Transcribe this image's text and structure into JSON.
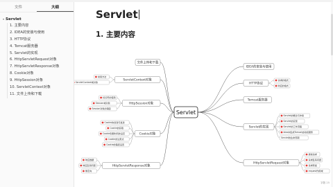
{
  "sidebar": {
    "tabs": [
      {
        "label": "文件"
      },
      {
        "label": "大纲"
      }
    ],
    "outline_root": "Servlet",
    "items": [
      {
        "label": "1. 主要内容"
      },
      {
        "label": "2. IDEA的安装与使用"
      },
      {
        "label": "3. HTTP协议"
      },
      {
        "label": "4. Tomcat服务器"
      },
      {
        "label": "5. Servlet的实现"
      },
      {
        "label": "6. HttpServletRequest对象"
      },
      {
        "label": "7. HttpServletResponse对象"
      },
      {
        "label": "8. Cookie对象"
      },
      {
        "label": "9. HttpSession对象"
      },
      {
        "label": "10. ServletContext对象"
      },
      {
        "label": "11. 文件上传和下载"
      }
    ]
  },
  "doc": {
    "title": "Servlet",
    "section_heading": "1. 主要内容"
  },
  "mindmap": {
    "center": "Servlet",
    "left": [
      {
        "label": "文件上传和下载",
        "children": []
      },
      {
        "label": "ServletContext对象",
        "children": [
          {
            "label": "常用方法"
          },
          {
            "label": "ServletContext域对象"
          }
        ]
      },
      {
        "label": "HttpSession对象",
        "children": [
          {
            "label": "标识符的使用"
          },
          {
            "label": "Session域对象"
          },
          {
            "label": "Session对象的销毁"
          }
        ]
      },
      {
        "label": "Cookie对象",
        "children": [
          {
            "label": "Cookie的创建与发送"
          },
          {
            "label": "Cookie的获取"
          },
          {
            "label": "Cookie到期时间的设定"
          },
          {
            "label": "Cookie的注意点"
          },
          {
            "label": "Cookie的路径设置"
          }
        ]
      },
      {
        "label": "HttpServletResponse对象",
        "children": [
          {
            "label": "响应数据"
          },
          {
            "label": "响应乱码问题"
          },
          {
            "label": "重定向"
          }
        ]
      }
    ],
    "right": [
      {
        "label": "IDEA的安装与使用",
        "children": []
      },
      {
        "label": "HTTP协议",
        "children": [
          {
            "label": "请求的格式"
          },
          {
            "label": "响应的格式"
          }
        ]
      },
      {
        "label": "Tomcat服务器",
        "children": []
      },
      {
        "label": "Servlet的实现",
        "children": [
          {
            "label": "Servlet的概念与作用"
          },
          {
            "label": "Servlet的实现"
          },
          {
            "label": "Servlet的工作流程"
          },
          {
            "label": "Idea中集成Tomcat启动和服务"
          },
          {
            "label": "Servlet的生命周期"
          }
        ]
      },
      {
        "label": "HttpServletRequest对象",
        "children": [
          {
            "label": "接收请求"
          },
          {
            "label": "请求乱码问题"
          },
          {
            "label": "请求转发"
          },
          {
            "label": "request作用域"
          }
        ]
      }
    ]
  },
  "status": {
    "word_count": "字数 25"
  },
  "colors": {
    "accent": "#e53935",
    "sidebar_bg": "#fafafa",
    "text": "#333333"
  }
}
